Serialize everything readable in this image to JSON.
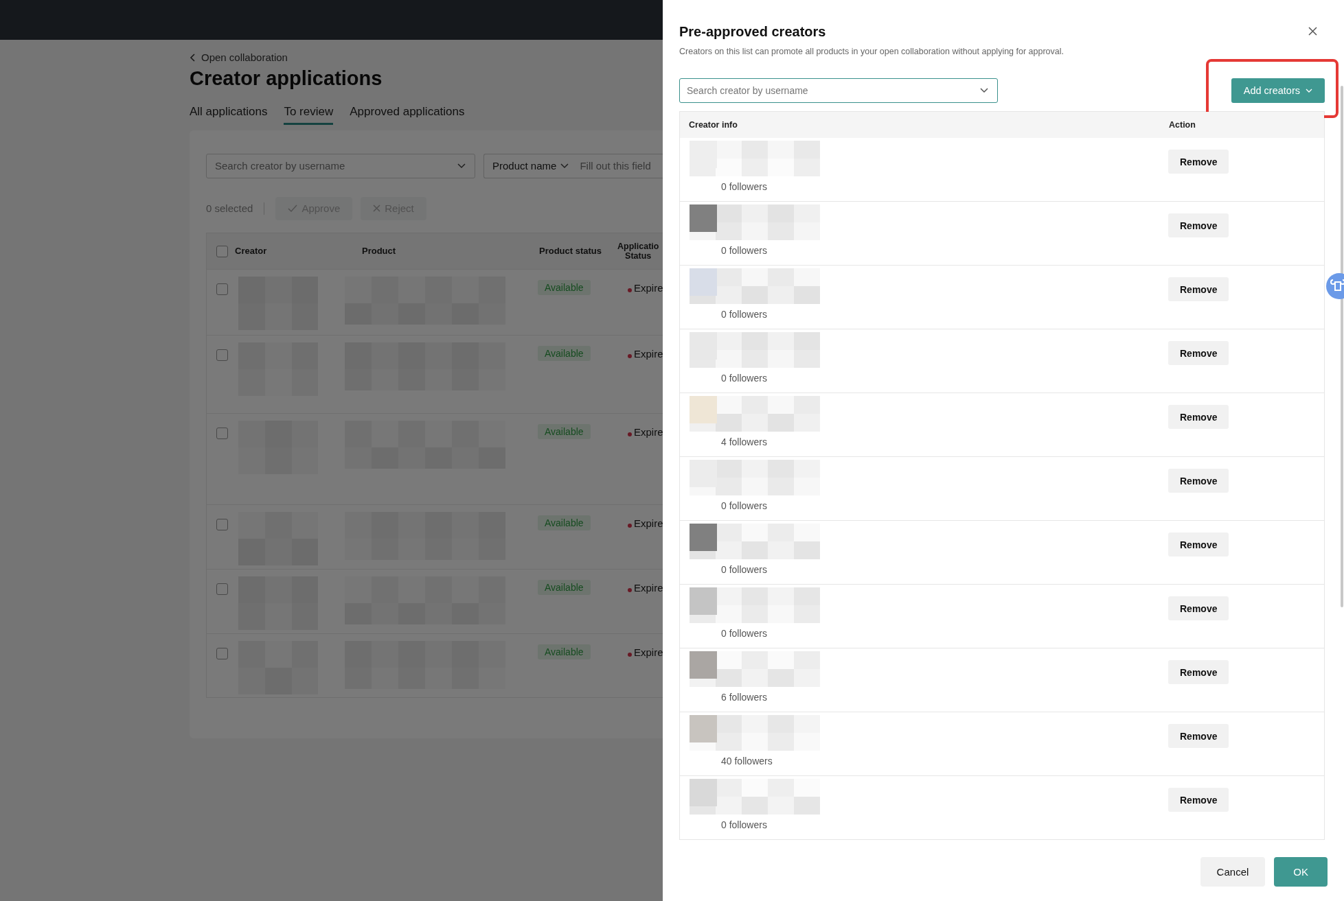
{
  "background_page": {
    "breadcrumb": "Open collaboration",
    "title": "Creator applications",
    "tabs": [
      {
        "label": "All applications",
        "selected": false
      },
      {
        "label": "To review",
        "selected": true
      },
      {
        "label": "Approved applications",
        "selected": false
      }
    ],
    "search": {
      "placeholder": "Search creator by username"
    },
    "filter": {
      "label": "Product name",
      "placeholder": "Fill out this field"
    },
    "selection": {
      "count": "0 selected",
      "actions": [
        {
          "label": "Approve",
          "kind": "approve",
          "disabled": true
        },
        {
          "label": "Reject",
          "kind": "reject",
          "disabled": true
        }
      ]
    },
    "table": {
      "select_all_checked": false,
      "columns": [
        "Creator",
        "Product",
        "Product status",
        "Applicatio\nStatus"
      ],
      "rows": [
        {
          "checked": false,
          "product_status": "Available",
          "application_status": "Expire"
        },
        {
          "checked": false,
          "product_status": "Available",
          "application_status": "Expire"
        },
        {
          "checked": false,
          "product_status": "Available",
          "application_status": "Expire"
        },
        {
          "checked": false,
          "product_status": "Available",
          "application_status": "Expire"
        },
        {
          "checked": false,
          "product_status": "Available",
          "application_status": "Expire"
        },
        {
          "checked": false,
          "product_status": "Available",
          "application_status": "Expire"
        }
      ]
    }
  },
  "drawer": {
    "title": "Pre-approved creators",
    "description": "Creators on this list can promote all products in your open collaboration without applying for approval.",
    "search": {
      "placeholder": "Search creator by username"
    },
    "add_button": {
      "label": "Add creators",
      "highlighted": true
    },
    "table": {
      "columns": [
        "Creator info",
        "Action"
      ],
      "rows": [
        {
          "followers": "0 followers",
          "action": "Remove"
        },
        {
          "followers": "0 followers",
          "action": "Remove"
        },
        {
          "followers": "0 followers",
          "action": "Remove"
        },
        {
          "followers": "0 followers",
          "action": "Remove"
        },
        {
          "followers": "4 followers",
          "action": "Remove"
        },
        {
          "followers": "0 followers",
          "action": "Remove"
        },
        {
          "followers": "0 followers",
          "action": "Remove"
        },
        {
          "followers": "0 followers",
          "action": "Remove"
        },
        {
          "followers": "6 followers",
          "action": "Remove"
        },
        {
          "followers": "40 followers",
          "action": "Remove"
        },
        {
          "followers": "0 followers",
          "action": "Remove"
        }
      ]
    },
    "footer": {
      "buttons": [
        {
          "label": "Cancel",
          "kind": "secondary"
        },
        {
          "label": "OK",
          "kind": "primary"
        }
      ]
    }
  }
}
